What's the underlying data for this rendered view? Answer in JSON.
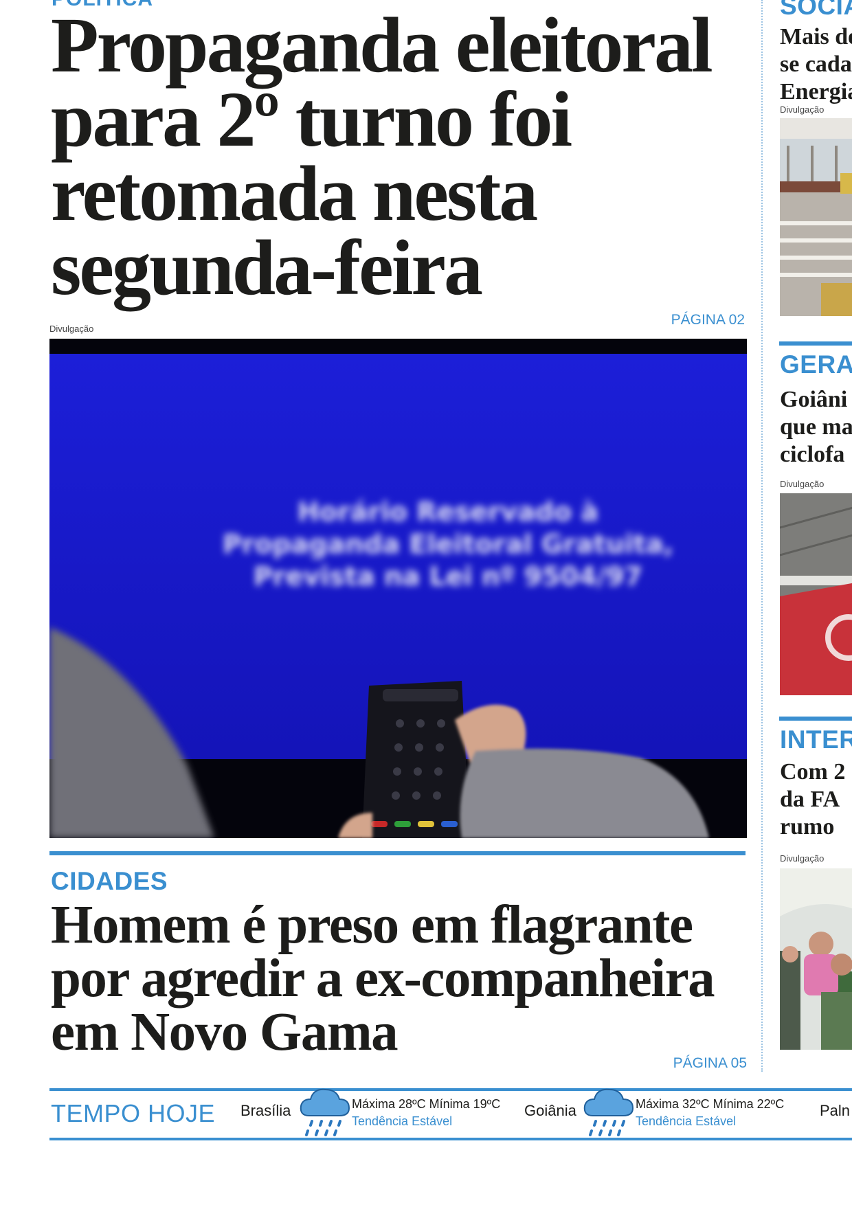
{
  "main_story": {
    "section": "POLÍTICA",
    "headline": "Propaganda eleitoral para 2º turno foi retomada nesta segunda-feira",
    "page_ref": "PÁGINA 02",
    "photo_credit": "Divulgação",
    "photo_screen_text": [
      "Horário Reservado à",
      "Propaganda Eleitoral Gratuita,",
      "Prevista na Lei nº 9504/97"
    ]
  },
  "second_story": {
    "section": "CIDADES",
    "headline": "Homem é preso em flagrante por agredir a ex-companheira em Novo Gama",
    "page_ref": "PÁGINA 05"
  },
  "sidebar": [
    {
      "section": "SOCIA",
      "headline_lines": [
        "Mais de",
        "se cada",
        "Energia"
      ],
      "photo_credit": "Divulgação"
    },
    {
      "section": "GERAL",
      "headline_lines": [
        "Goiâni",
        "que ma",
        "ciclofa"
      ],
      "photo_credit": "Divulgação"
    },
    {
      "section": "INTER",
      "headline_lines": [
        "Com 2",
        "da FA",
        "rumo"
      ],
      "photo_credit": "Divulgação"
    }
  ],
  "weather": {
    "title": "TEMPO HOJE",
    "cities": [
      {
        "name": "Brasília",
        "max_min": "Máxima 28ºC Mínima 19ºC",
        "trend": "Tendência Estável",
        "icon": "rain-cloud-icon"
      },
      {
        "name": "Goiânia",
        "max_min": "Máxima 32ºC Mínima 22ºC",
        "trend": "Tendência Estável",
        "icon": "rain-cloud-icon"
      },
      {
        "name": "Paln"
      }
    ]
  },
  "colors": {
    "accent": "#3a8fd0",
    "text": "#1d1d1b",
    "tv_screen": "#1f1fd6",
    "bike_lane": "#c8323a"
  }
}
